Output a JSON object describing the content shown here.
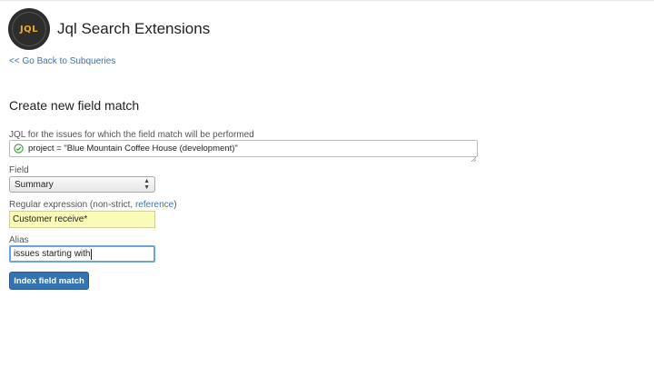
{
  "app": {
    "title": "Jql Search Extensions",
    "logo_text": "JQL"
  },
  "nav": {
    "back_link": "<< Go Back to Subqueries"
  },
  "page": {
    "title": "Create new field match"
  },
  "form": {
    "jql_label": "JQL for the issues for which the field match will be performed",
    "jql_value": "project = \"Blue Mountain Coffee House (development)\"",
    "field_label": "Field",
    "field_value": "Summary",
    "regex_label": "Regular expression (non-strict, ",
    "regex_link": "reference",
    "regex_label_end": ")",
    "regex_value": "Customer receive*",
    "alias_label": "Alias",
    "alias_value": "issues starting with",
    "submit_label": "Index field match"
  },
  "colors": {
    "link": "#3b73af",
    "button": "#3572b0",
    "regex_bg": "#fbfbb9",
    "logo_bg": "#2d2d2d",
    "logo_accent": "#e9a93a",
    "valid_icon": "#3a9a3a"
  },
  "icons": {
    "jql_status": "check-circle-icon",
    "select_arrow": "chevron-up-down-icon"
  }
}
